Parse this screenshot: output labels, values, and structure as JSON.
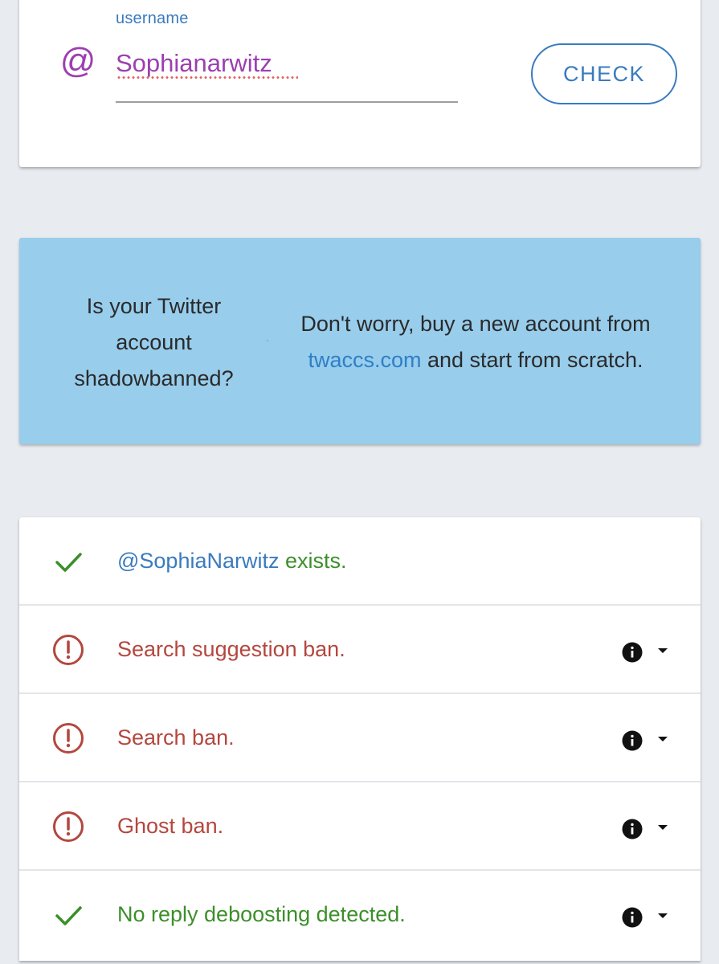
{
  "search": {
    "label": "username",
    "at_symbol": "@",
    "input_value": "Sophianarwitz",
    "button_label": "CHECK"
  },
  "ad": {
    "question": "Is your Twitter account shadowbanned?",
    "pitch_before": "Don't worry, buy a new account from ",
    "link_text": "twaccs.com",
    "pitch_after": " and start from scratch."
  },
  "results": [
    {
      "status": "ok",
      "icon": "check-icon",
      "handle": "@SophiaNarwitz",
      "text": " exists.",
      "has_info": false
    },
    {
      "status": "ban",
      "icon": "alert-circle-icon",
      "handle": "",
      "text": "Search suggestion ban.",
      "has_info": true
    },
    {
      "status": "ban",
      "icon": "alert-circle-icon",
      "handle": "",
      "text": "Search ban.",
      "has_info": true
    },
    {
      "status": "ban",
      "icon": "alert-circle-icon",
      "handle": "",
      "text": "Ghost ban.",
      "has_info": true
    },
    {
      "status": "ok",
      "icon": "check-icon",
      "handle": "",
      "text": "No reply deboosting detected.",
      "has_info": true
    }
  ],
  "colors": {
    "accent_blue": "#3a7bbf",
    "input_purple": "#9c3fb0",
    "ok_green": "#3c8f2a",
    "ban_red": "#b4473e",
    "banner_bg": "#98cdec",
    "page_bg": "#e8ebf0"
  }
}
